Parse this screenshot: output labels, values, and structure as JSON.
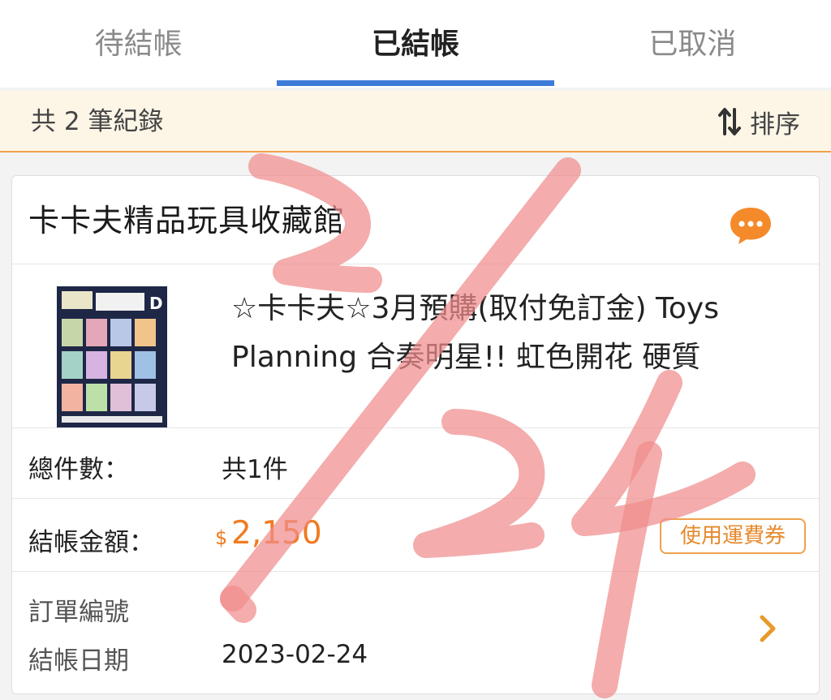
{
  "tabs": [
    {
      "label": "待結帳",
      "active": false
    },
    {
      "label": "已結帳",
      "active": true
    },
    {
      "label": "已取消",
      "active": false
    }
  ],
  "summary": {
    "count_text": "共 2 筆紀錄",
    "sort_label": "排序"
  },
  "order": {
    "shop_name": "卡卡夫精品玩具收藏館",
    "product_title": "☆卡卡夫☆3月預購(取付免訂金) Toys Planning 合奏明星!! 虹色開花 硬質",
    "total_items_label": "總件數：",
    "total_items_value": "共1件",
    "amount_label": "結帳金額：",
    "amount_currency": "$",
    "amount_value": "2,150",
    "coupon_label": "使用運費券",
    "order_no_label": "訂單編號",
    "checkout_date_label": "結帳日期",
    "checkout_date_value": "2023-02-24"
  },
  "handwriting": "2/24",
  "colors": {
    "accent_blue": "#3d7bd8",
    "accent_orange": "#f07a1f",
    "summary_bg": "#fdf6e7",
    "handwriting_red": "#f28f8f"
  }
}
